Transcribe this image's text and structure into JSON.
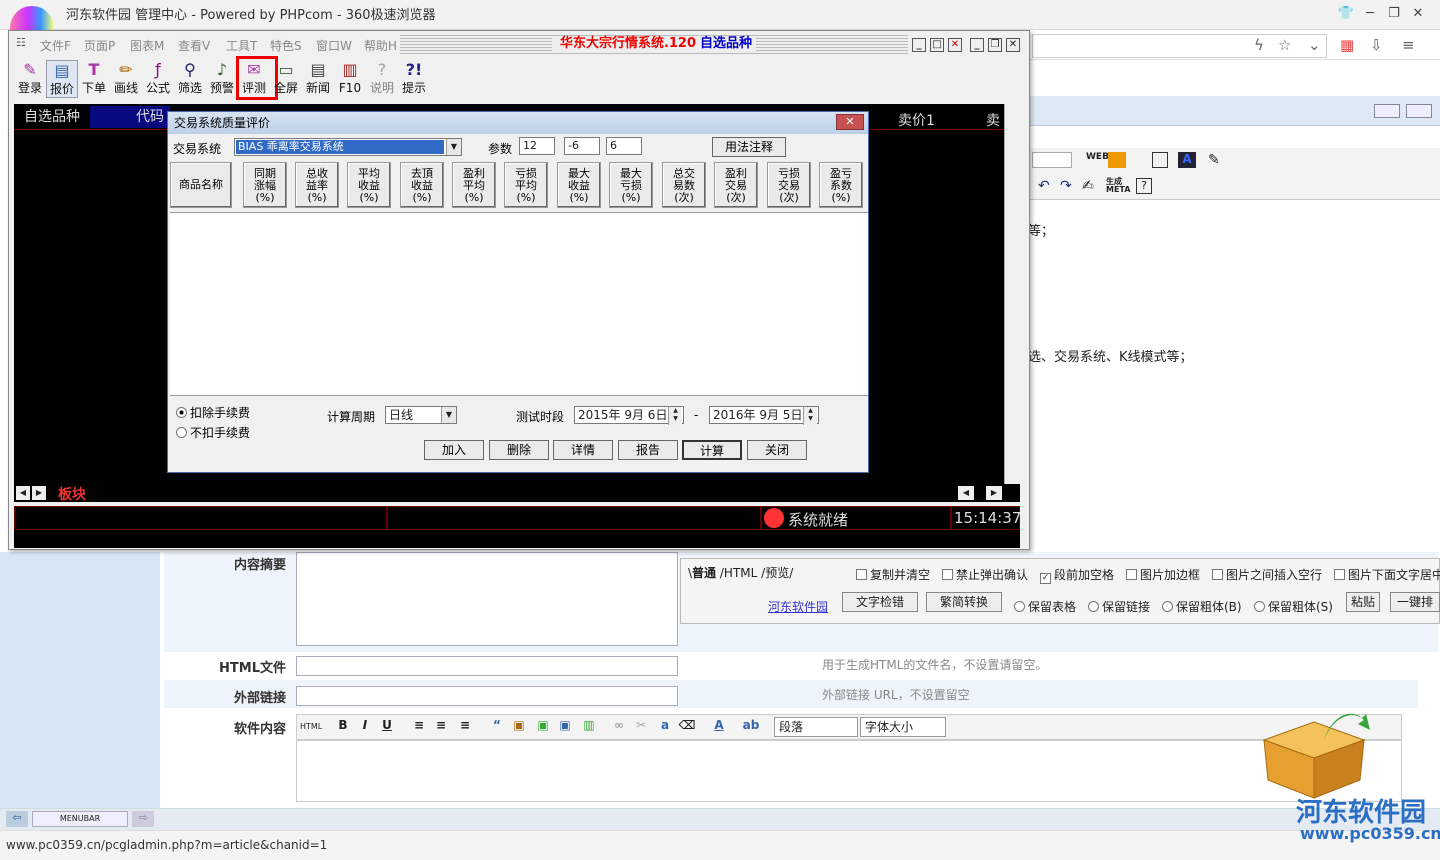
{
  "browser": {
    "tab_title": "河东软件园 管理中心 - Powered by PHPcom - 360极速浏览器",
    "status_url": "www.pc0359.cn/pcgladmin.php?m=article&chanid=1",
    "taskbar_label": "MENUBAR"
  },
  "app": {
    "menu": [
      "文件F",
      "页面P",
      "图表M",
      "查看V",
      "工具T",
      "特色S",
      "窗口W",
      "帮助H"
    ],
    "title": "华东大宗行情系统.120",
    "title_suffix": "自选品种",
    "toolbar": [
      "登录",
      "报价",
      "下单",
      "画线",
      "公式",
      "筛选",
      "预警",
      "评测",
      "全屏",
      "新闻",
      "F10",
      "说明",
      "提示"
    ],
    "quote_headers": {
      "tab": "自选品种",
      "code": "代码",
      "ask1": "卖价1",
      "ask": "卖"
    },
    "sector_tab": "板块",
    "status_text": "系统就绪",
    "clock": "15:14:37"
  },
  "dialog": {
    "title": "交易系统质量评价",
    "system_label": "交易系统",
    "system_value": "BIAS  乖离率交易系统",
    "param_label": "参数",
    "params": [
      "12",
      "-6",
      "6"
    ],
    "usage_button": "用法注释",
    "name_header": "商品名称",
    "columns": [
      [
        "同期",
        "涨幅",
        "(%)"
      ],
      [
        "总收",
        "益率",
        "(%)"
      ],
      [
        "平均",
        "收益",
        "(%)"
      ],
      [
        "去頂",
        "收益",
        "(%)"
      ],
      [
        "盈利",
        "平均",
        "(%)"
      ],
      [
        "亏损",
        "平均",
        "(%)"
      ],
      [
        "最大",
        "收益",
        "(%)"
      ],
      [
        "最大",
        "亏损",
        "(%)"
      ],
      [
        "总交",
        "易数",
        "(次)"
      ],
      [
        "盈利",
        "交易",
        "(次)"
      ],
      [
        "亏损",
        "交易",
        "(次)"
      ],
      [
        "盈亏",
        "系数",
        "(%)"
      ]
    ],
    "fee_options": [
      "扣除手续费",
      "不扣手续费"
    ],
    "period_label": "计算周期",
    "period_value": "日线",
    "test_range_label": "测试时段",
    "start_date": "2015年 9月 6日",
    "end_date": "2016年 9月 5日",
    "range_dash": "-",
    "buttons": [
      "加入",
      "删除",
      "详情",
      "报告",
      "计算",
      "关闭"
    ]
  },
  "background_page": {
    "summary_label": "内容摘要",
    "html_file_label": "HTML文件",
    "html_file_hint": "用于生成HTML的文件名，不设置请留空。",
    "external_link_label": "外部链接",
    "external_link_hint": "外部链接 URL，不设置留空",
    "content_label": "软件内容",
    "paragraph_select": "段落",
    "font_size_select": "字体大小",
    "right_text_1": "等；",
    "right_text_2": "选、交易系统、K线模式等；",
    "editor_tabs": [
      "普通",
      "HTML",
      "预览"
    ],
    "editor_checks": [
      "复制并清空",
      "禁止弹出确认",
      "段前加空格",
      "图片加边框",
      "图片之间插入空行",
      "图片下面文字居中"
    ],
    "site_link": "河东软件园",
    "text_check_button": "文字检错",
    "convert_button": "繁简转换",
    "keep_options": [
      "保留表格",
      "保留链接",
      "保留粗体(B)",
      "保留粗体(S)"
    ],
    "paste_button": "粘贴",
    "one_key_button": "一键排"
  },
  "watermark": {
    "name": "河东软件园",
    "url": "www.pc0359.cn"
  }
}
